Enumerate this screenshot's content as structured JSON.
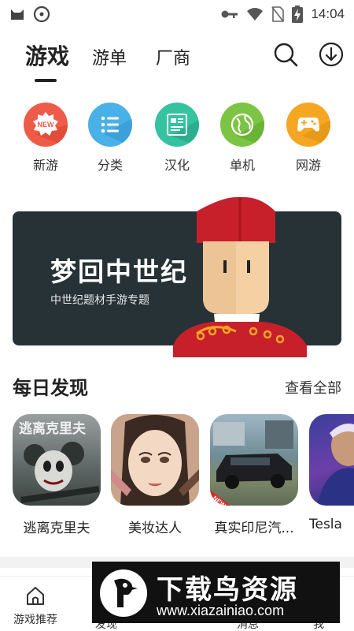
{
  "status_bar": {
    "time": "14:04",
    "icons": [
      "cat-app-icon",
      "record-icon",
      "key-icon",
      "wifi-icon",
      "no-sim-icon",
      "battery-charging-icon"
    ]
  },
  "top_nav": {
    "tabs": [
      {
        "label": "游戏",
        "active": true
      },
      {
        "label": "游单",
        "active": false
      },
      {
        "label": "厂商",
        "active": false
      }
    ],
    "actions": [
      "search-icon",
      "download-icon"
    ]
  },
  "categories": [
    {
      "label": "新游",
      "icon": "new-badge-icon",
      "color": "#ee5b49"
    },
    {
      "label": "分类",
      "icon": "list-icon",
      "color": "#4ab0e8"
    },
    {
      "label": "汉化",
      "icon": "translate-icon",
      "color": "#35c2a0"
    },
    {
      "label": "单机",
      "icon": "globe-icon",
      "color": "#7cc443"
    },
    {
      "label": "网游",
      "icon": "gamepad-icon",
      "color": "#f5a623"
    }
  ],
  "banner": {
    "title": "梦回中世纪",
    "subtitle": "中世纪题材手游专题",
    "background": "#263236"
  },
  "daily": {
    "title": "每日发现",
    "more": "查看全部",
    "games": [
      {
        "name": "逃离克里夫",
        "thumb_text": "逃离克里夫"
      },
      {
        "name": "美妆达人"
      },
      {
        "name": "真实印尼汽...",
        "badge": "NEW"
      },
      {
        "name": "Tesla"
      }
    ]
  },
  "bottom_nav": {
    "items": [
      {
        "label": "游戏推荐",
        "icon": "home-icon"
      },
      {
        "label": "发现"
      },
      {
        "label": "消息"
      },
      {
        "label": "我"
      }
    ]
  },
  "watermark": {
    "title": "下载鸟资源",
    "url": "www.xiazainiao.com"
  }
}
